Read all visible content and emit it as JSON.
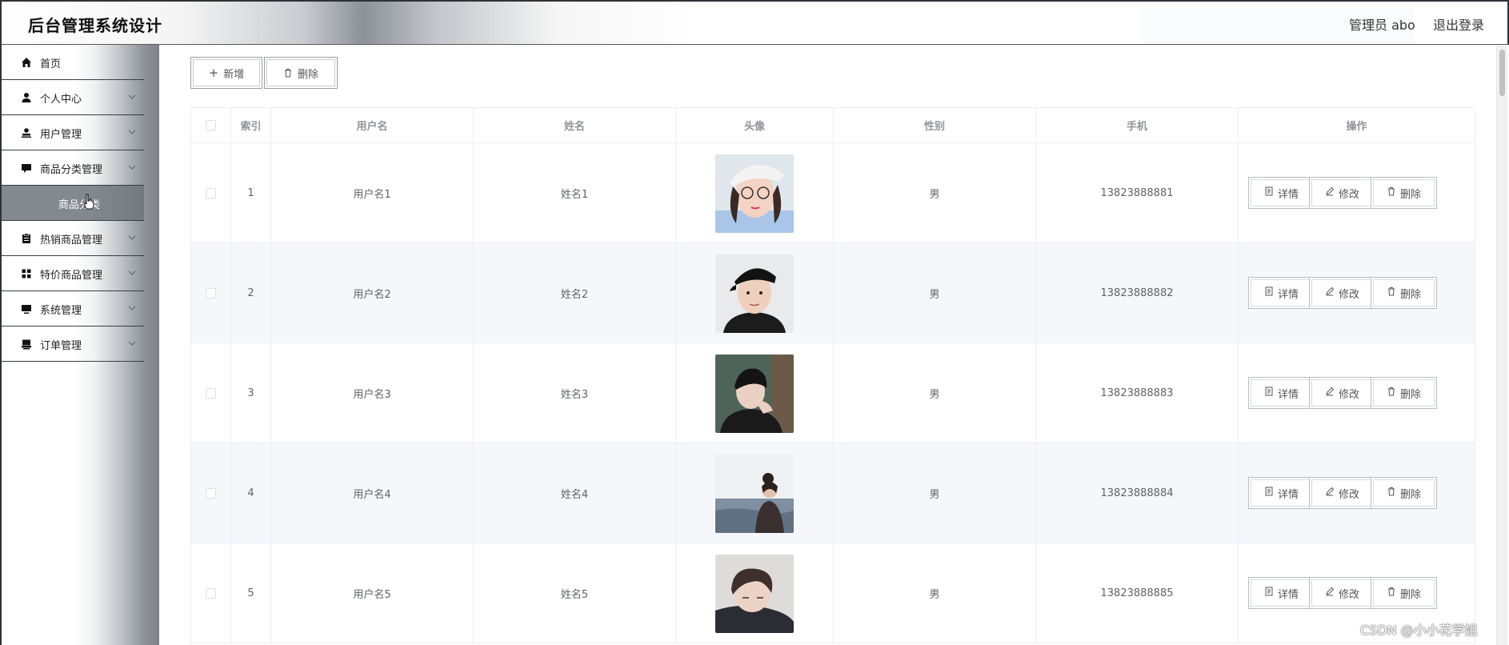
{
  "app": {
    "title": "后台管理系统设计"
  },
  "header": {
    "admin_label": "管理员 abo",
    "logout_label": "退出登录"
  },
  "sidebar": {
    "items": [
      {
        "label": "首页",
        "icon": "home-icon",
        "has_chevron": false
      },
      {
        "label": "个人中心",
        "icon": "user-icon",
        "has_chevron": true
      },
      {
        "label": "用户管理",
        "icon": "user-manage-icon",
        "has_chevron": true
      },
      {
        "label": "商品分类管理",
        "icon": "message-icon",
        "has_chevron": true
      },
      {
        "label": "热销商品管理",
        "icon": "clipboard-icon",
        "has_chevron": true
      },
      {
        "label": "特价商品管理",
        "icon": "grid-icon",
        "has_chevron": true
      },
      {
        "label": "系统管理",
        "icon": "monitor-icon",
        "has_chevron": true
      },
      {
        "label": "订单管理",
        "icon": "printer-icon",
        "has_chevron": true
      }
    ],
    "active_sub": {
      "label": "商品分类"
    }
  },
  "toolbar": {
    "add_label": "新增",
    "delete_label": "删除"
  },
  "table": {
    "headers": [
      "索引",
      "用户名",
      "姓名",
      "头像",
      "性别",
      "手机",
      "操作"
    ],
    "rows": [
      {
        "index": "1",
        "username": "用户名1",
        "name": "姓名1",
        "avatar": "avatar-1",
        "gender": "男",
        "phone": "13823888881"
      },
      {
        "index": "2",
        "username": "用户名2",
        "name": "姓名2",
        "avatar": "avatar-2",
        "gender": "男",
        "phone": "13823888882"
      },
      {
        "index": "3",
        "username": "用户名3",
        "name": "姓名3",
        "avatar": "avatar-3",
        "gender": "男",
        "phone": "13823888883"
      },
      {
        "index": "4",
        "username": "用户名4",
        "name": "姓名4",
        "avatar": "avatar-4",
        "gender": "男",
        "phone": "13823888884"
      },
      {
        "index": "5",
        "username": "用户名5",
        "name": "姓名5",
        "avatar": "avatar-5",
        "gender": "男",
        "phone": "13823888885"
      }
    ],
    "actions": {
      "detail": "详情",
      "edit": "修改",
      "delete": "删除"
    }
  },
  "watermark": "CSDN @小小花学姐",
  "colors": {
    "stripe": "#f5f7fa",
    "border": "#ebeef5",
    "text": "#606266",
    "header_text": "#909399"
  }
}
